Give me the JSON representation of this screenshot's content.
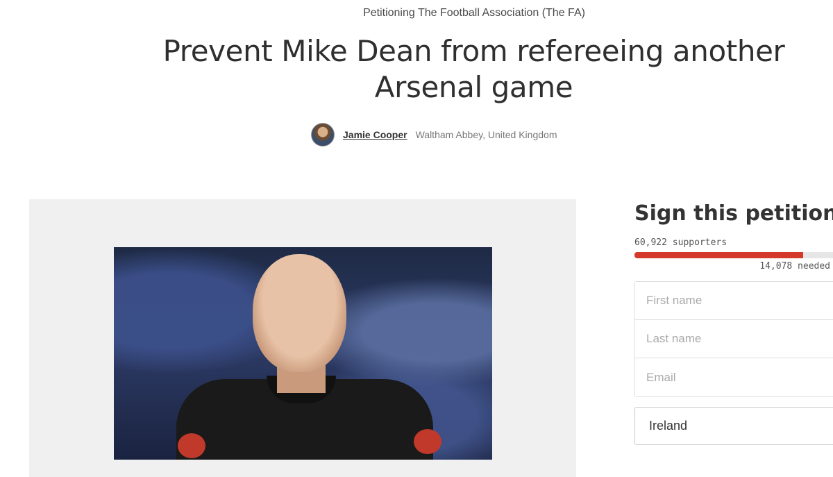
{
  "header": {
    "petitioning": "Petitioning The Football Association (The FA)",
    "title": "Prevent Mike Dean from refereeing another Arsenal game",
    "author_name": "Jamie Cooper",
    "author_location": "Waltham Abbey, United Kingdom"
  },
  "media": {
    "image_icon": "referee-photo"
  },
  "sign": {
    "title": "Sign this petition",
    "supporters": "60,922 supporters",
    "progress": 0.81,
    "needed": "14,078 needed",
    "first_name_placeholder": "First name",
    "last_name_placeholder": "Last name",
    "email_placeholder": "Email",
    "country": "Ireland"
  },
  "colors": {
    "progress_fill": "#d33a2c",
    "panel_bg": "#f0f0f0"
  }
}
